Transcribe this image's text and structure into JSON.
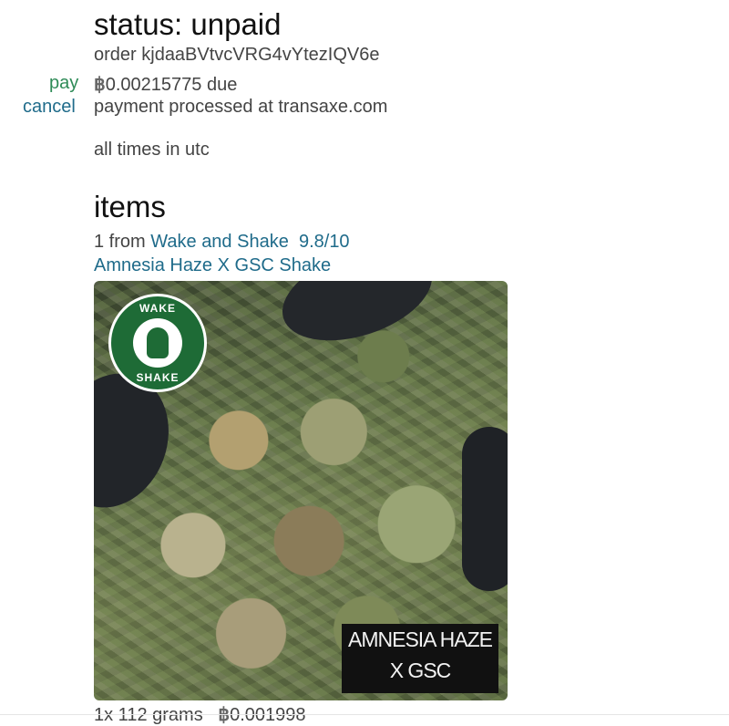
{
  "status": {
    "label": "status: unpaid"
  },
  "order": {
    "line": "order kjdaaBVtvcVRG4vYtezIQV6e"
  },
  "actions": {
    "pay_label": "pay",
    "cancel_label": "cancel"
  },
  "payment": {
    "currency_symbol": "฿",
    "amount_due": "0.00215775 due",
    "processor_note": "payment processed at transaxe.com"
  },
  "timezone_note": "all times in utc",
  "items": {
    "heading": "items",
    "vendor_prefix": "1 from",
    "vendor_name": "Wake and Shake",
    "vendor_rating": "9.8/10",
    "product_name": "Amnesia Haze X GSC Shake",
    "image": {
      "logo_top_text": "WAKE",
      "logo_bottom_text": "SHAKE",
      "caption_line1": "AMNESIA HAZE",
      "caption_line2": "X GSC"
    },
    "quantity_line": "1x 112 grams",
    "line_price": "0.001998"
  },
  "colors": {
    "link": "#1f6b8a",
    "pay": "#2e8b57",
    "text": "#444444"
  }
}
